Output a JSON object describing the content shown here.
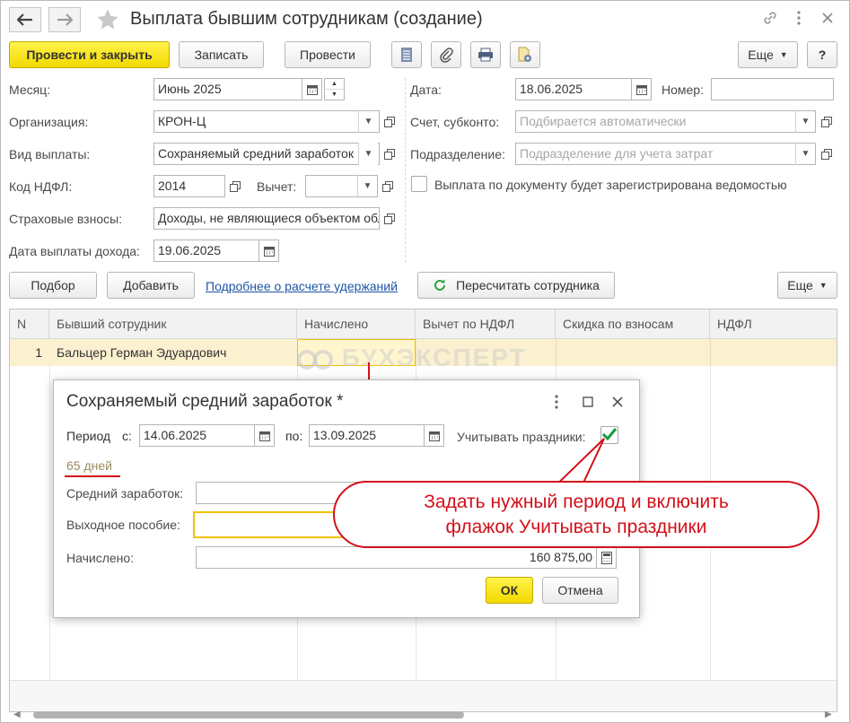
{
  "window": {
    "title": "Выплата бывшим сотрудникам (создание)"
  },
  "toolbar": {
    "post_close": "Провести и закрыть",
    "save": "Записать",
    "post": "Провести",
    "more": "Еще",
    "help": "?"
  },
  "form": {
    "month_label": "Месяц:",
    "month_value": "Июнь 2025",
    "org_label": "Организация:",
    "org_value": "КРОН-Ц",
    "payment_type_label": "Вид выплаты:",
    "payment_type_value": "Сохраняемый средний заработок",
    "ndfl_code_label": "Код НДФЛ:",
    "ndfl_code_value": "2014",
    "deduction_label": "Вычет:",
    "deduction_value": "",
    "insurance_label": "Страховые взносы:",
    "insurance_value": "Доходы, не являющиеся объектом обложения",
    "income_date_label": "Дата выплаты дохода:",
    "income_date_value": "19.06.2025",
    "date_label": "Дата:",
    "date_value": "18.06.2025",
    "number_label": "Номер:",
    "number_value": "",
    "account_label": "Счет, субконто:",
    "account_placeholder": "Подбирается автоматически",
    "division_label": "Подразделение:",
    "division_placeholder": "Подразделение для учета затрат",
    "statement_checkbox_label": "Выплата по документу будет зарегистрирована ведомостью",
    "statement_checked": false
  },
  "table_toolbar": {
    "pick": "Подбор",
    "add": "Добавить",
    "details_link": "Подробнее о расчете удержаний",
    "recalc": "Пересчитать сотрудника",
    "more": "Еще"
  },
  "table": {
    "columns": [
      "N",
      "Бывший сотрудник",
      "Начислено",
      "Вычет по НДФЛ",
      "Скидка по взносам",
      "НДФЛ"
    ],
    "rows": [
      [
        "1",
        "Бальцер Герман Эдуардович",
        "",
        "",
        "",
        ""
      ]
    ]
  },
  "watermark": "БУХЭКСПЕРТ",
  "dialog": {
    "title": "Сохраняемый средний заработок *",
    "period_label": "Период",
    "from_label": "с:",
    "from_value": "14.06.2025",
    "to_label": "по:",
    "to_value": "13.09.2025",
    "holidays_label": "Учитывать праздники:",
    "holidays_checked": true,
    "days": "65 дней",
    "avg_label": "Средний заработок:",
    "avg_value": "",
    "severance_label": "Выходное пособие:",
    "severance_value": "",
    "accrued_label": "Начислено:",
    "accrued_value": "160 875,00",
    "ok": "ОК",
    "cancel": "Отмена"
  },
  "callout": {
    "line1": "Задать нужный период и включить",
    "line2": "флажок Учитывать праздники"
  },
  "colors": {
    "accent_yellow": "#f2d900",
    "selected_row": "#fbf0cf",
    "callout_red": "#d3101a",
    "link_blue": "#1d55a6",
    "check_green": "#1a9a3a"
  }
}
